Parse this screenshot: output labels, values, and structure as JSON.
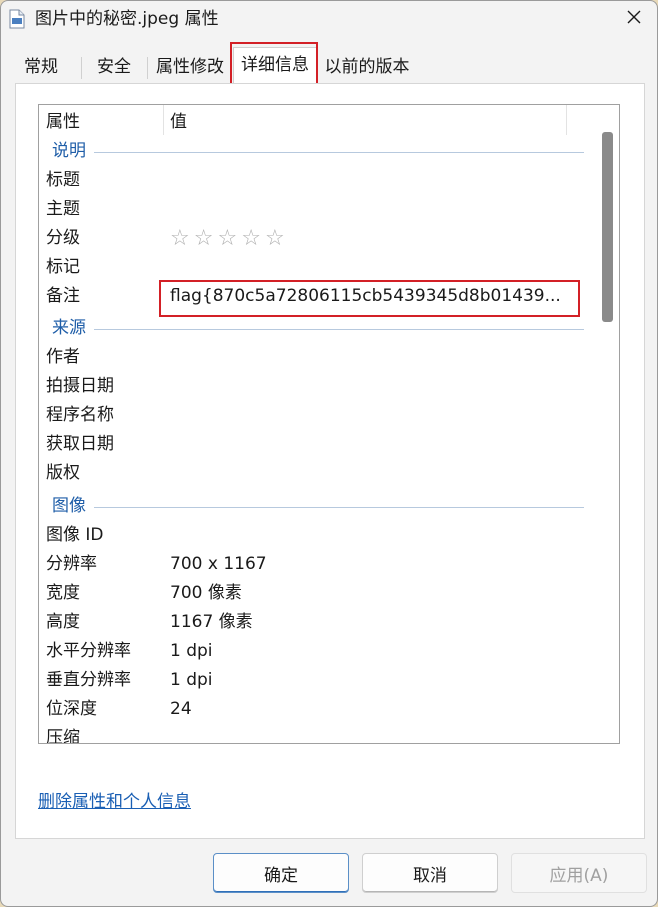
{
  "window": {
    "title": "图片中的秘密.jpeg 属性",
    "file_icon": "jpeg-file-icon",
    "close_icon": "close-icon"
  },
  "tabs": [
    {
      "label": "常规",
      "active": false
    },
    {
      "label": "安全",
      "active": false
    },
    {
      "label": "属性修改",
      "active": false
    },
    {
      "label": "详细信息",
      "active": true
    },
    {
      "label": "以前的版本",
      "active": false
    }
  ],
  "list": {
    "headers": {
      "property": "属性",
      "value": "值"
    },
    "groups": {
      "description": "说明",
      "origin": "来源",
      "image": "图像"
    },
    "description_rows": {
      "title": {
        "label": "标题",
        "value": ""
      },
      "subject": {
        "label": "主题",
        "value": ""
      },
      "rating": {
        "label": "分级",
        "stars": 0,
        "max_stars": 5
      },
      "tags": {
        "label": "标记",
        "value": ""
      },
      "comments": {
        "label": "备注",
        "value": "flag{870c5a72806115cb5439345d8b01439..."
      }
    },
    "origin_rows": {
      "authors": {
        "label": "作者",
        "value": ""
      },
      "date_taken": {
        "label": "拍摄日期",
        "value": ""
      },
      "program_name": {
        "label": "程序名称",
        "value": ""
      },
      "date_acquired": {
        "label": "获取日期",
        "value": ""
      },
      "copyright": {
        "label": "版权",
        "value": ""
      }
    },
    "image_rows": {
      "image_id": {
        "label": "图像 ID",
        "value": ""
      },
      "dimensions": {
        "label": "分辨率",
        "value": "700 x 1167"
      },
      "width": {
        "label": "宽度",
        "value": "700 像素"
      },
      "height": {
        "label": "高度",
        "value": "1167 像素"
      },
      "h_resolution": {
        "label": "水平分辨率",
        "value": "1 dpi"
      },
      "v_resolution": {
        "label": "垂直分辨率",
        "value": "1 dpi"
      },
      "bit_depth": {
        "label": "位深度",
        "value": "24"
      },
      "compression": {
        "label": "压缩",
        "value": ""
      }
    }
  },
  "remove_link": "删除属性和个人信息",
  "buttons": {
    "ok": "确定",
    "cancel": "取消",
    "apply": "应用(A)"
  },
  "colors": {
    "highlight": "#d32026",
    "group_label": "#1f5ea8",
    "link": "#1a5fb4"
  }
}
